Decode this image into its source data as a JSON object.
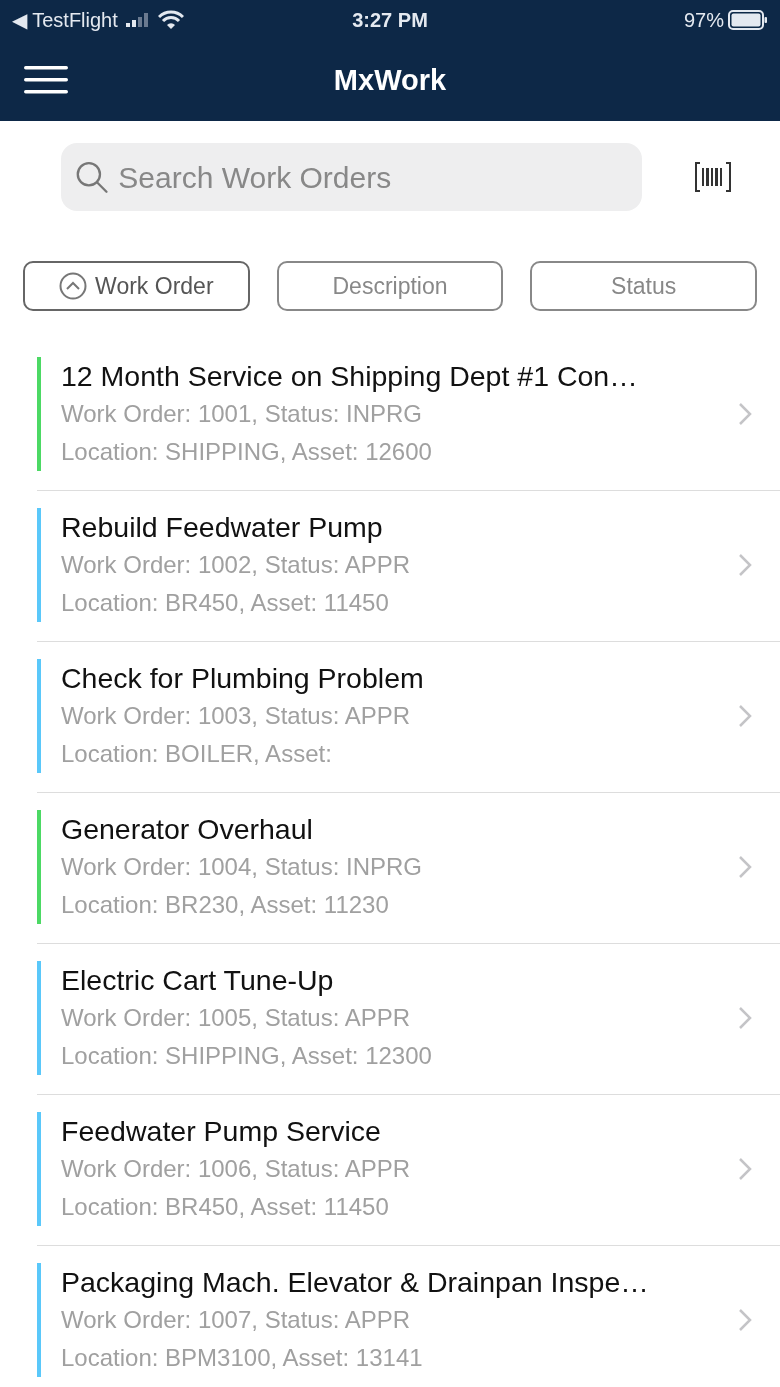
{
  "status_bar": {
    "back_app": "◀ TestFlight",
    "time": "3:27 PM",
    "battery": "97%"
  },
  "header": {
    "title": "MxWork"
  },
  "search": {
    "placeholder": "Search Work Orders"
  },
  "sort_buttons": [
    {
      "label": "Work Order",
      "selected": true
    },
    {
      "label": "Description",
      "selected": false
    },
    {
      "label": "Status",
      "selected": false
    }
  ],
  "work_orders": [
    {
      "title": "12 Month Service on Shipping Dept #1 Con…",
      "line_1": "Work Order: 1001, Status: INPRG",
      "line_2": "Location: SHIPPING, Asset: 12600",
      "color": "#4cd964"
    },
    {
      "title": "Rebuild Feedwater Pump",
      "line_1": "Work Order: 1002, Status: APPR",
      "line_2": "Location: BR450, Asset: 11450",
      "color": "#5ac8fa"
    },
    {
      "title": "Check for Plumbing Problem",
      "line_1": "Work Order: 1003, Status: APPR",
      "line_2": "Location: BOILER, Asset:",
      "color": "#5ac8fa"
    },
    {
      "title": "Generator Overhaul",
      "line_1": "Work Order: 1004, Status: INPRG",
      "line_2": "Location: BR230, Asset: 11230",
      "color": "#4cd964"
    },
    {
      "title": "Electric Cart Tune-Up",
      "line_1": "Work Order: 1005, Status: APPR",
      "line_2": "Location: SHIPPING, Asset: 12300",
      "color": "#5ac8fa"
    },
    {
      "title": "Feedwater Pump Service",
      "line_1": "Work Order: 1006, Status: APPR",
      "line_2": "Location: BR450, Asset: 11450",
      "color": "#5ac8fa"
    },
    {
      "title": "Packaging Mach. Elevator & Drainpan Inspe…",
      "line_1": "Work Order: 1007, Status: APPR",
      "line_2": "Location: BPM3100, Asset: 13141",
      "color": "#5ac8fa"
    }
  ]
}
